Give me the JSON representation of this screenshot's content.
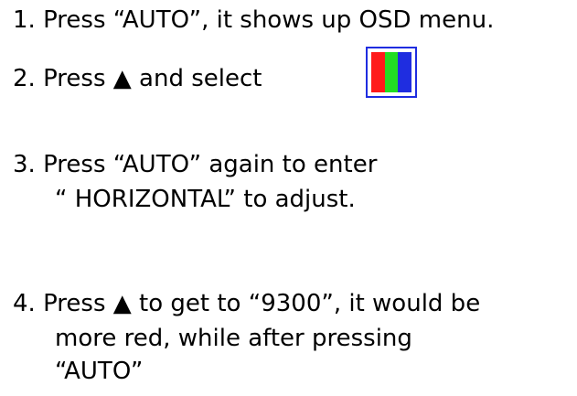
{
  "steps": [
    {
      "number": "1.",
      "text": "Press “AUTO”, it shows up OSD menu."
    },
    {
      "number": "2.",
      "text": "Press ▲ and select"
    },
    {
      "number": "3.",
      "text": "Press “AUTO” again to enter",
      "continuation": "“ HORIZONTAL” to adjust."
    },
    {
      "number": "4.",
      "text": "Press ▲ to get to “9300”, it would be",
      "continuation": "more red, while after pressing",
      "continuation2": "“AUTO”"
    }
  ],
  "icon": {
    "name": "rgb-color-icon",
    "colors": [
      "#ff1a1a",
      "#22dd22",
      "#1f2de0"
    ],
    "border": "#1f2de0"
  }
}
